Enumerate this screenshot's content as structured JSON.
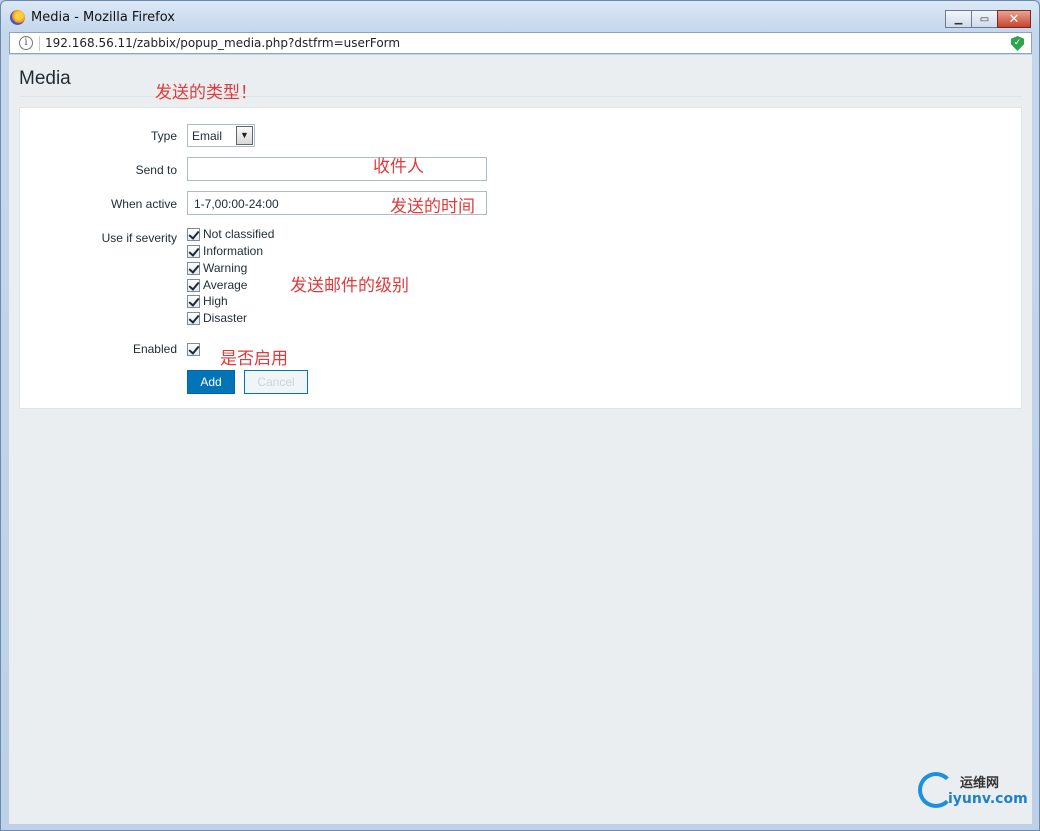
{
  "window": {
    "title": "Media - Mozilla Firefox",
    "url": "192.168.56.11/zabbix/popup_media.php?dstfrm=userForm"
  },
  "page": {
    "title": "Media"
  },
  "form": {
    "type_label": "Type",
    "type_value": "Email",
    "send_to_label": "Send to",
    "send_to_value": "",
    "when_active_label": "When active",
    "when_active_value": "1-7,00:00-24:00",
    "severity_label": "Use if severity",
    "severities": [
      {
        "label": "Not classified",
        "checked": true
      },
      {
        "label": "Information",
        "checked": true
      },
      {
        "label": "Warning",
        "checked": true
      },
      {
        "label": "Average",
        "checked": true
      },
      {
        "label": "High",
        "checked": true
      },
      {
        "label": "Disaster",
        "checked": true
      }
    ],
    "enabled_label": "Enabled",
    "enabled_checked": true,
    "add_label": "Add",
    "cancel_label": "Cancel"
  },
  "annotations": {
    "type_note": "发送的类型！",
    "send_to_note": "收件人",
    "when_active_note": "发送的时间",
    "severity_note": "发送邮件的级别",
    "enabled_note": "是否启用"
  },
  "watermark": {
    "cn": "运维网",
    "en": "iyunv.com"
  },
  "colors": {
    "accent": "#0275b8",
    "annotation": "#e03b3b"
  }
}
